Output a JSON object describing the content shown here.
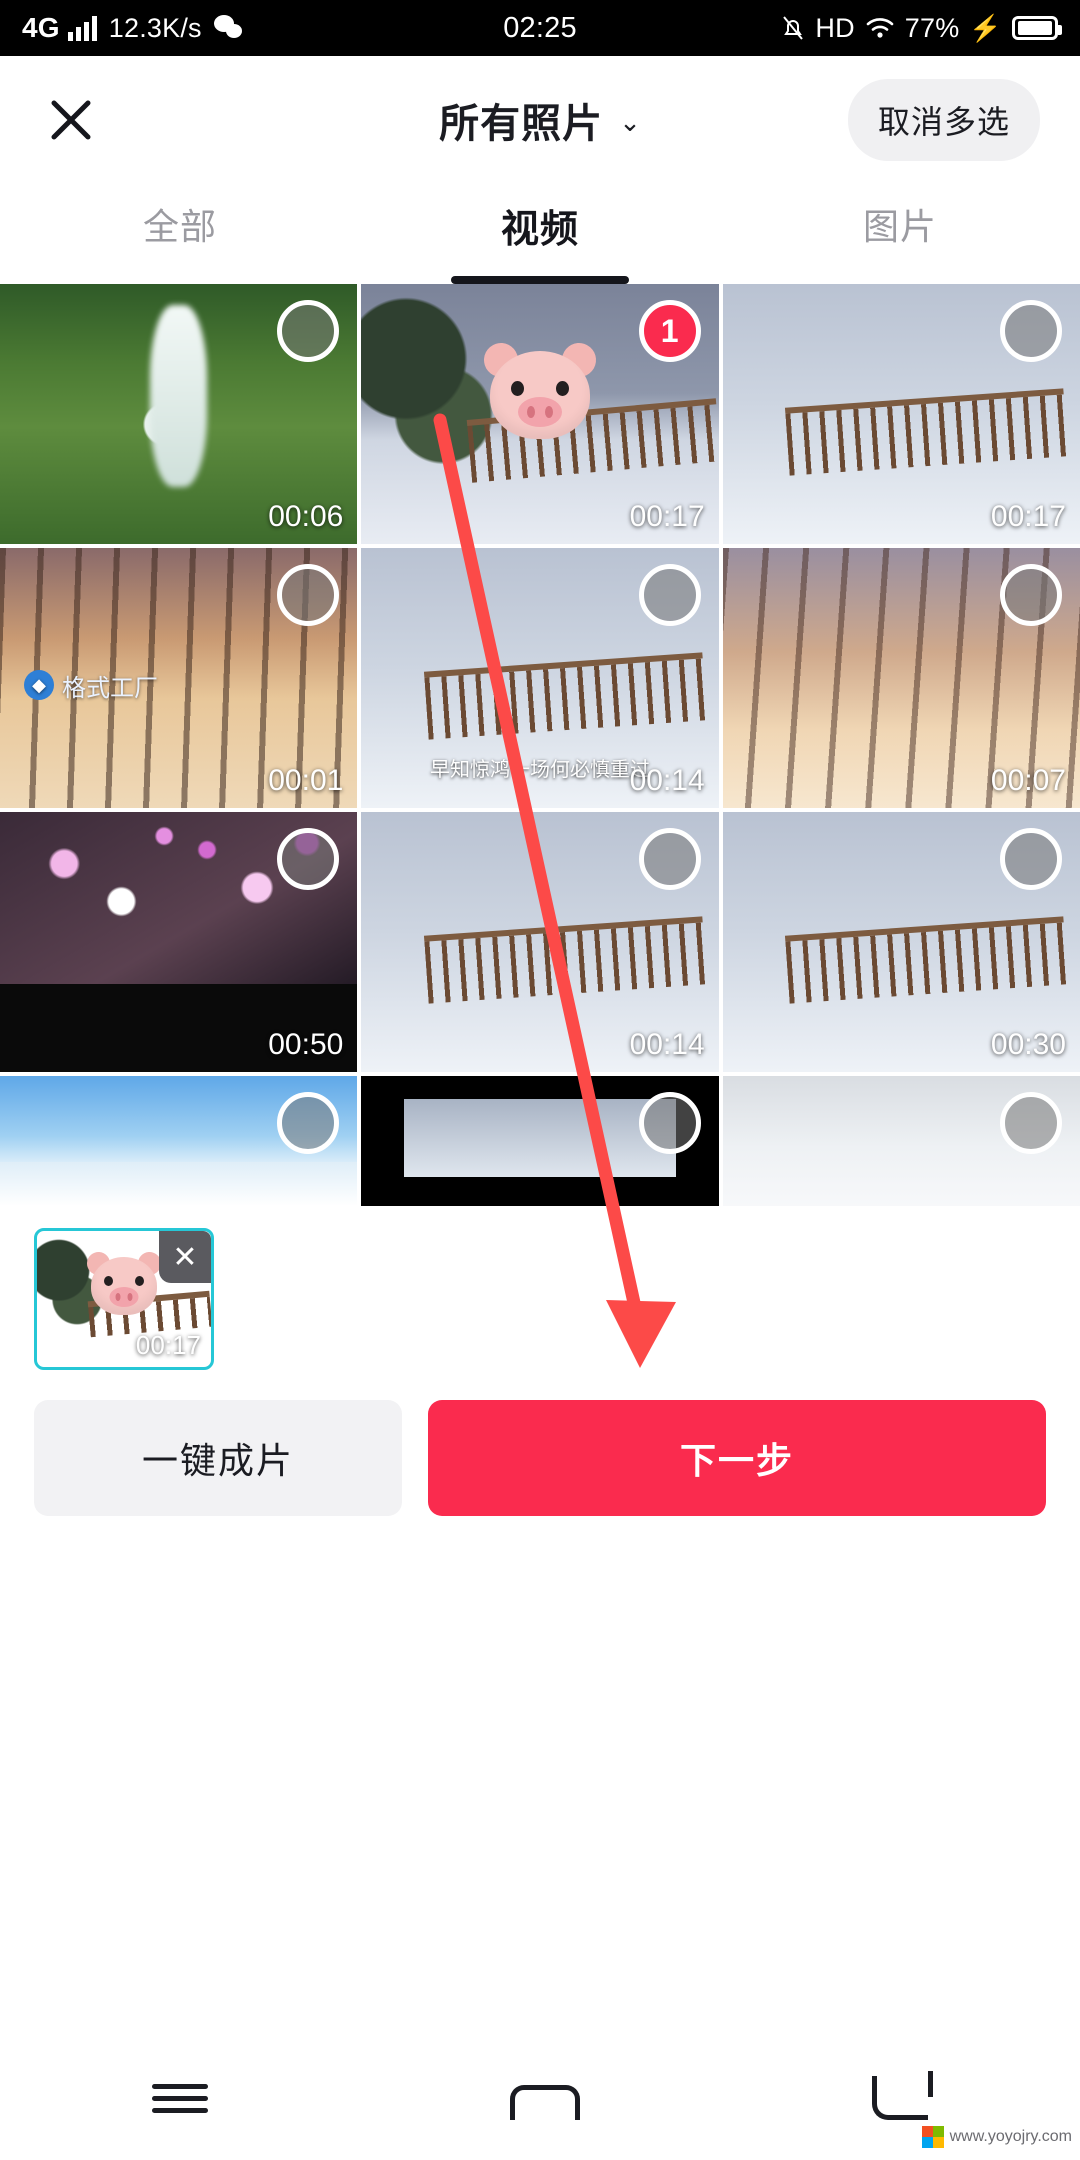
{
  "status_bar": {
    "network_type": "4G",
    "speed": "12.3K/s",
    "time": "02:25",
    "hd_label": "HD",
    "battery_percent": "77%",
    "icons": [
      "signal-bars-icon",
      "wechat-icon",
      "mute-bell-icon",
      "hd-icon",
      "wifi-icon",
      "charging-bolt-icon",
      "battery-icon"
    ]
  },
  "header": {
    "close_label": "✕",
    "title": "所有照片",
    "chevron": "⌄",
    "cancel_multiselect_label": "取消多选"
  },
  "tabs": [
    {
      "label": "全部",
      "active": false
    },
    {
      "label": "视频",
      "active": true
    },
    {
      "label": "图片",
      "active": false
    }
  ],
  "grid": {
    "items": [
      {
        "duration": "00:06",
        "selected": false,
        "badge": "",
        "art": "t-waterfall",
        "overlay": ""
      },
      {
        "duration": "00:17",
        "selected": true,
        "badge": "1",
        "art": "t-snowbridge",
        "overlay": "pig"
      },
      {
        "duration": "00:17",
        "selected": false,
        "badge": "",
        "art": "t-snowbridge2",
        "overlay": ""
      },
      {
        "duration": "00:01",
        "selected": false,
        "badge": "",
        "art": "t-sunset",
        "overlay": "watermark",
        "watermark": "格式工厂"
      },
      {
        "duration": "00:14",
        "selected": false,
        "badge": "",
        "art": "t-snowbridge2",
        "overlay": "subtitle",
        "subtitle": "早知惊鸿一场何必慎重过"
      },
      {
        "duration": "00:07",
        "selected": false,
        "badge": "",
        "art": "t-sunset2",
        "overlay": ""
      },
      {
        "duration": "00:50",
        "selected": false,
        "badge": "",
        "art": "t-blossom",
        "overlay": ""
      },
      {
        "duration": "00:14",
        "selected": false,
        "badge": "",
        "art": "t-snowbridge2",
        "overlay": ""
      },
      {
        "duration": "00:30",
        "selected": false,
        "badge": "",
        "art": "t-snowbridge2",
        "overlay": ""
      },
      {
        "duration": "",
        "selected": false,
        "badge": "",
        "art": "t-birds",
        "overlay": ""
      },
      {
        "duration": "",
        "selected": false,
        "badge": "",
        "art": "t-blackbar",
        "overlay": ""
      },
      {
        "duration": "",
        "selected": false,
        "badge": "",
        "art": "t-fog",
        "overlay": ""
      }
    ]
  },
  "tray": {
    "selected_clip": {
      "duration": "00:17",
      "remove_label": "✕"
    }
  },
  "actions": {
    "auto_make_label": "一键成片",
    "next_label": "下一步"
  },
  "nav_bar": {
    "items": [
      "menu-icon",
      "home-icon",
      "back-icon"
    ]
  },
  "watermark": {
    "text": "www.yoyojry.com"
  },
  "colors": {
    "accent_red": "#fa2b4e",
    "tab_active": "#15161c",
    "tab_inactive": "#9b9ba1",
    "chip_border": "#26c7d6",
    "annotation_arrow": "#fc4a48"
  }
}
